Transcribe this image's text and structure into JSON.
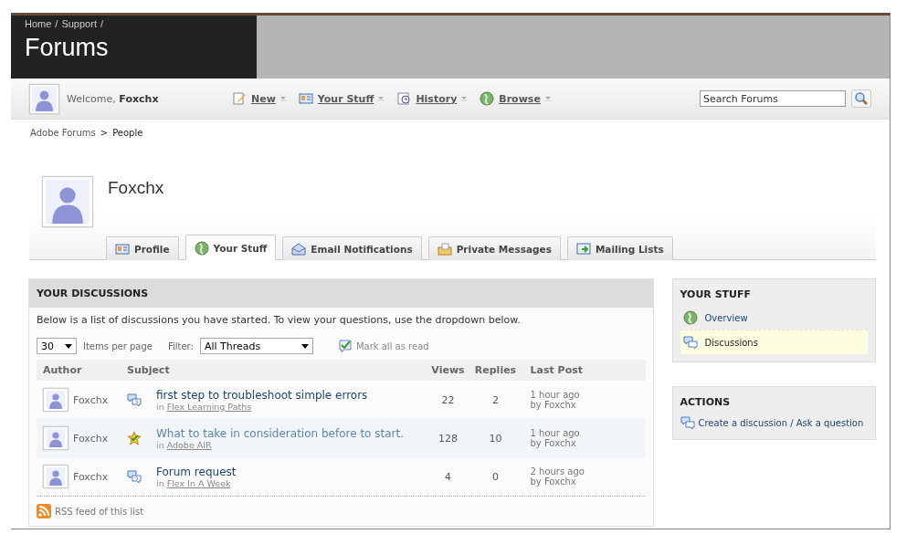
{
  "header": {
    "breadcrumb": [
      "Home",
      "Support"
    ],
    "separator": "/",
    "title": "Forums"
  },
  "toolbar": {
    "welcome": "Welcome,",
    "user": "Foxchx",
    "menus": [
      {
        "kind": "new",
        "label": "New"
      },
      {
        "kind": "stuff",
        "label": "Your Stuff"
      },
      {
        "kind": "history",
        "label": "History"
      },
      {
        "kind": "browse",
        "label": "Browse"
      }
    ],
    "search": {
      "placeholder": "Search Forums"
    }
  },
  "breadcrumb": {
    "items": [
      "Adobe Forums",
      "People"
    ],
    "separator": ">"
  },
  "profile": {
    "name": "Foxchx"
  },
  "tabs": [
    {
      "kind": "profile",
      "label": "Profile",
      "selected": false
    },
    {
      "kind": "browse",
      "label": "Your Stuff",
      "selected": true
    },
    {
      "kind": "email",
      "label": "Email Notifications",
      "selected": false
    },
    {
      "kind": "messages",
      "label": "Private Messages",
      "selected": false
    },
    {
      "kind": "mailing",
      "label": "Mailing Lists",
      "selected": false
    }
  ],
  "discussions": {
    "title": "YOUR DISCUSSIONS",
    "intro": "Below is a list of discussions you have started. To view your questions, use the dropdown below.",
    "per_page": "30",
    "per_page_label": "Items per page",
    "filter_label": "Filter:",
    "filter": "All Threads",
    "mark_read": "Mark all as read",
    "columns": [
      "Author",
      "Subject",
      "Views",
      "Replies",
      "Last Post"
    ],
    "rows": [
      {
        "author": "Foxchx",
        "kind": "question",
        "subject": "first step to troubleshoot simple errors",
        "in": "in",
        "place": "Flex Learning Paths",
        "views": "22",
        "replies": "2",
        "time": "1 hour ago",
        "by": "by Foxchx",
        "read": false
      },
      {
        "author": "Foxchx",
        "kind": "answered",
        "subject": "What to take in consideration before to start.",
        "in": "in",
        "place": "Adobe AIR",
        "views": "128",
        "replies": "10",
        "time": "1 hour ago",
        "by": "by Foxchx",
        "read": true
      },
      {
        "author": "Foxchx",
        "kind": "question",
        "subject": "Forum request",
        "in": "in",
        "place": "Flex In A Week",
        "views": "4",
        "replies": "0",
        "time": "2 hours ago",
        "by": "by Foxchx",
        "read": false
      }
    ],
    "rss": "RSS feed of this list"
  },
  "your_stuff": {
    "title": "YOUR STUFF",
    "items": [
      {
        "kind": "browse",
        "label": "Overview",
        "selected": false
      },
      {
        "kind": "discussions",
        "label": "Discussions",
        "selected": true
      }
    ]
  },
  "actions": {
    "title": "ACTIONS",
    "items": [
      {
        "kind": "discussions",
        "label": "Create a discussion / Ask a question"
      }
    ]
  }
}
